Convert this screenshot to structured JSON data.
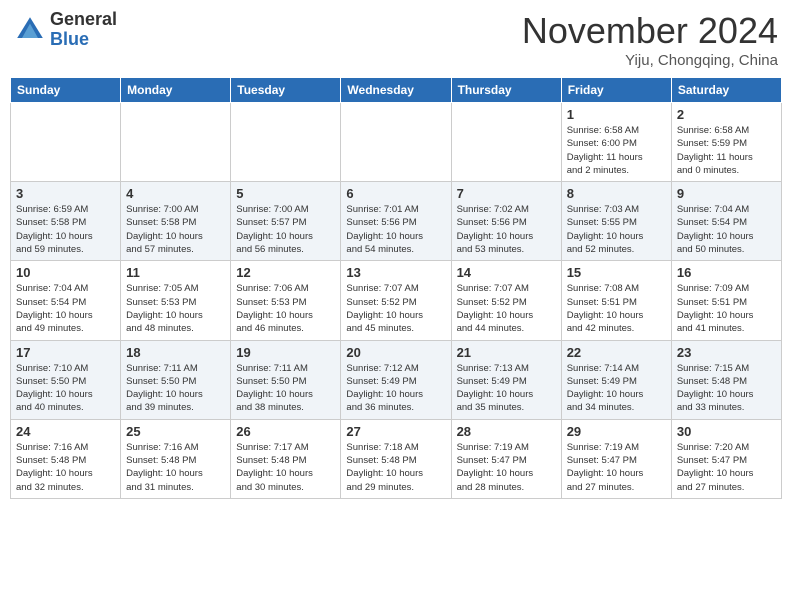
{
  "logo": {
    "general": "General",
    "blue": "Blue"
  },
  "header": {
    "month": "November 2024",
    "location": "Yiju, Chongqing, China"
  },
  "weekdays": [
    "Sunday",
    "Monday",
    "Tuesday",
    "Wednesday",
    "Thursday",
    "Friday",
    "Saturday"
  ],
  "weeks": [
    [
      {
        "day": "",
        "info": ""
      },
      {
        "day": "",
        "info": ""
      },
      {
        "day": "",
        "info": ""
      },
      {
        "day": "",
        "info": ""
      },
      {
        "day": "",
        "info": ""
      },
      {
        "day": "1",
        "info": "Sunrise: 6:58 AM\nSunset: 6:00 PM\nDaylight: 11 hours\nand 2 minutes."
      },
      {
        "day": "2",
        "info": "Sunrise: 6:58 AM\nSunset: 5:59 PM\nDaylight: 11 hours\nand 0 minutes."
      }
    ],
    [
      {
        "day": "3",
        "info": "Sunrise: 6:59 AM\nSunset: 5:58 PM\nDaylight: 10 hours\nand 59 minutes."
      },
      {
        "day": "4",
        "info": "Sunrise: 7:00 AM\nSunset: 5:58 PM\nDaylight: 10 hours\nand 57 minutes."
      },
      {
        "day": "5",
        "info": "Sunrise: 7:00 AM\nSunset: 5:57 PM\nDaylight: 10 hours\nand 56 minutes."
      },
      {
        "day": "6",
        "info": "Sunrise: 7:01 AM\nSunset: 5:56 PM\nDaylight: 10 hours\nand 54 minutes."
      },
      {
        "day": "7",
        "info": "Sunrise: 7:02 AM\nSunset: 5:56 PM\nDaylight: 10 hours\nand 53 minutes."
      },
      {
        "day": "8",
        "info": "Sunrise: 7:03 AM\nSunset: 5:55 PM\nDaylight: 10 hours\nand 52 minutes."
      },
      {
        "day": "9",
        "info": "Sunrise: 7:04 AM\nSunset: 5:54 PM\nDaylight: 10 hours\nand 50 minutes."
      }
    ],
    [
      {
        "day": "10",
        "info": "Sunrise: 7:04 AM\nSunset: 5:54 PM\nDaylight: 10 hours\nand 49 minutes."
      },
      {
        "day": "11",
        "info": "Sunrise: 7:05 AM\nSunset: 5:53 PM\nDaylight: 10 hours\nand 48 minutes."
      },
      {
        "day": "12",
        "info": "Sunrise: 7:06 AM\nSunset: 5:53 PM\nDaylight: 10 hours\nand 46 minutes."
      },
      {
        "day": "13",
        "info": "Sunrise: 7:07 AM\nSunset: 5:52 PM\nDaylight: 10 hours\nand 45 minutes."
      },
      {
        "day": "14",
        "info": "Sunrise: 7:07 AM\nSunset: 5:52 PM\nDaylight: 10 hours\nand 44 minutes."
      },
      {
        "day": "15",
        "info": "Sunrise: 7:08 AM\nSunset: 5:51 PM\nDaylight: 10 hours\nand 42 minutes."
      },
      {
        "day": "16",
        "info": "Sunrise: 7:09 AM\nSunset: 5:51 PM\nDaylight: 10 hours\nand 41 minutes."
      }
    ],
    [
      {
        "day": "17",
        "info": "Sunrise: 7:10 AM\nSunset: 5:50 PM\nDaylight: 10 hours\nand 40 minutes."
      },
      {
        "day": "18",
        "info": "Sunrise: 7:11 AM\nSunset: 5:50 PM\nDaylight: 10 hours\nand 39 minutes."
      },
      {
        "day": "19",
        "info": "Sunrise: 7:11 AM\nSunset: 5:50 PM\nDaylight: 10 hours\nand 38 minutes."
      },
      {
        "day": "20",
        "info": "Sunrise: 7:12 AM\nSunset: 5:49 PM\nDaylight: 10 hours\nand 36 minutes."
      },
      {
        "day": "21",
        "info": "Sunrise: 7:13 AM\nSunset: 5:49 PM\nDaylight: 10 hours\nand 35 minutes."
      },
      {
        "day": "22",
        "info": "Sunrise: 7:14 AM\nSunset: 5:49 PM\nDaylight: 10 hours\nand 34 minutes."
      },
      {
        "day": "23",
        "info": "Sunrise: 7:15 AM\nSunset: 5:48 PM\nDaylight: 10 hours\nand 33 minutes."
      }
    ],
    [
      {
        "day": "24",
        "info": "Sunrise: 7:16 AM\nSunset: 5:48 PM\nDaylight: 10 hours\nand 32 minutes."
      },
      {
        "day": "25",
        "info": "Sunrise: 7:16 AM\nSunset: 5:48 PM\nDaylight: 10 hours\nand 31 minutes."
      },
      {
        "day": "26",
        "info": "Sunrise: 7:17 AM\nSunset: 5:48 PM\nDaylight: 10 hours\nand 30 minutes."
      },
      {
        "day": "27",
        "info": "Sunrise: 7:18 AM\nSunset: 5:48 PM\nDaylight: 10 hours\nand 29 minutes."
      },
      {
        "day": "28",
        "info": "Sunrise: 7:19 AM\nSunset: 5:47 PM\nDaylight: 10 hours\nand 28 minutes."
      },
      {
        "day": "29",
        "info": "Sunrise: 7:19 AM\nSunset: 5:47 PM\nDaylight: 10 hours\nand 27 minutes."
      },
      {
        "day": "30",
        "info": "Sunrise: 7:20 AM\nSunset: 5:47 PM\nDaylight: 10 hours\nand 27 minutes."
      }
    ]
  ]
}
